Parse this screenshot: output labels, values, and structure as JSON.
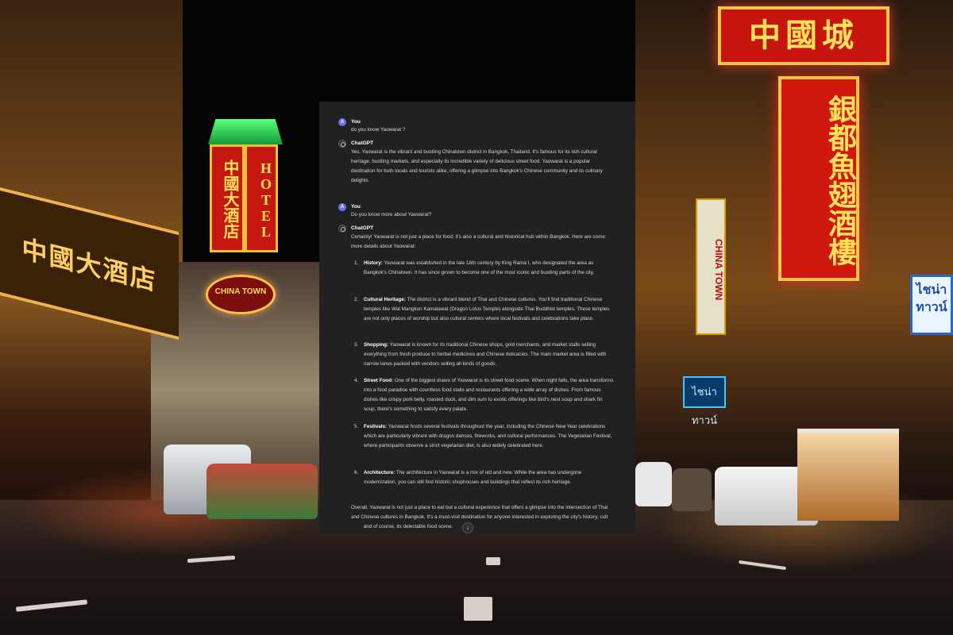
{
  "background": {
    "signs": {
      "top_sign": "中國城",
      "vertical_sign": "銀都魚翅酒樓",
      "hotel_cn": "中國大酒店",
      "hotel_en": "HOTEL",
      "oval_sign": "CHINA TOWN",
      "left_board": "中國大酒店",
      "right_blue": "ไชน่าทาวน์",
      "right_vertical": "CHINA TOWN",
      "green_sign": "ไชน่าทาวน์"
    },
    "colors": {
      "sky": "#050505",
      "neon_red": "#c8140e",
      "neon_gold": "#f5c44a",
      "neon_green": "#5cff7a"
    }
  },
  "chat": {
    "background": "#212121",
    "messages": [
      {
        "author": "You",
        "avatar_letter": "A",
        "text": "do you know Yaowarat ?"
      },
      {
        "author": "ChatGPT",
        "text": "Yes, Yaowarat is the vibrant and bustling Chinatown district in Bangkok, Thailand. It's famous for its rich cultural heritage, bustling markets, and especially its incredible variety of delicious street food. Yaowarat is a popular destination for both locals and tourists alike, offering a glimpse into Bangkok's Chinese community and its culinary delights."
      },
      {
        "author": "You",
        "avatar_letter": "A",
        "text": "Do you know more about Yaowarat?"
      },
      {
        "author": "ChatGPT",
        "intro": "Certainly! Yaowarat is not just a place for food; it's also a cultural and historical hub within Bangkok. Here are some more details about Yaowarat:",
        "items": [
          {
            "num": "1.",
            "heading": "History:",
            "text": "Yaowarat was established in the late 18th century by King Rama I, who designated the area as Bangkok's Chinatown. It has since grown to become one of the most iconic and bustling parts of the city."
          },
          {
            "num": "2.",
            "heading": "Cultural Heritage:",
            "text": "The district is a vibrant blend of Thai and Chinese cultures. You'll find traditional Chinese temples like Wat Mangkon Kamalawat (Dragon Lotus Temple) alongside Thai Buddhist temples. These temples are not only places of worship but also cultural centers where local festivals and celebrations take place."
          },
          {
            "num": "3.",
            "heading": "Shopping:",
            "text": "Yaowarat is known for its traditional Chinese shops, gold merchants, and market stalls selling everything from fresh produce to herbal medicines and Chinese delicacies. The main market area is filled with narrow lanes packed with vendors selling all kinds of goods."
          },
          {
            "num": "4.",
            "heading": "Street Food:",
            "text": "One of the biggest draws of Yaowarat is its street food scene. When night falls, the area transforms into a food paradise with countless food stalls and restaurants offering a wide array of dishes. From famous dishes like crispy pork belly, roasted duck, and dim sum to exotic offerings like bird's nest soup and shark fin soup, there's something to satisfy every palate."
          },
          {
            "num": "5.",
            "heading": "Festivals:",
            "text": "Yaowarat hosts several festivals throughout the year, including the Chinese New Year celebrations which are particularly vibrant with dragon dances, fireworks, and cultural performances. The Vegetarian Festival, where participants observe a strict vegetarian diet, is also widely celebrated here."
          },
          {
            "num": "6.",
            "heading": "Architecture:",
            "text": "The architecture in Yaowarat is a mix of old and new. While the area has undergone modernization, you can still find historic shophouses and buildings that reflect its rich heritage."
          }
        ],
        "outro": "Overall, Yaowarat is not just a place to eat but a cultural experience that offers a glimpse into the intersection of Thai and Chinese cultures in Bangkok. It's a must-visit destination for anyone interested in exploring the city's history, cult",
        "outro_end": "and of course, its delectable food scene."
      }
    ],
    "scroll_button_icon": "↓"
  }
}
